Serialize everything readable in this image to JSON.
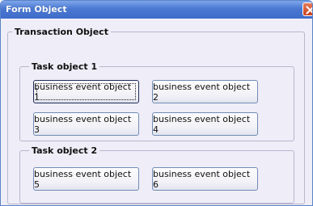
{
  "window": {
    "title": "Form Object"
  },
  "group": {
    "title": "Transaction Object",
    "tasks": [
      {
        "title": "Task object 1",
        "buttons": [
          "business event object 1",
          "business event object 2",
          "business event object 3",
          "business event object 4"
        ]
      },
      {
        "title": "Task object 2",
        "buttons": [
          "business event object 5",
          "business event object 6"
        ]
      }
    ]
  },
  "colors": {
    "title_bar": "#4a78d2",
    "close_button": "#d9542f",
    "background": "#efedf7"
  },
  "icons": {
    "close": "close-icon"
  }
}
